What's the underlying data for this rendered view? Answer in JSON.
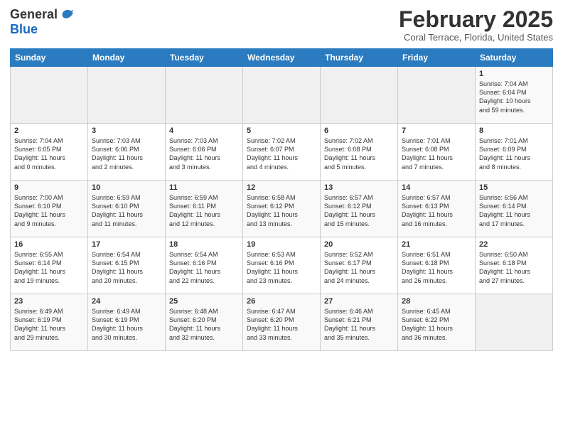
{
  "logo": {
    "general": "General",
    "blue": "Blue"
  },
  "header": {
    "month": "February 2025",
    "location": "Coral Terrace, Florida, United States"
  },
  "days_of_week": [
    "Sunday",
    "Monday",
    "Tuesday",
    "Wednesday",
    "Thursday",
    "Friday",
    "Saturday"
  ],
  "weeks": [
    [
      {
        "day": "",
        "info": "",
        "empty": true
      },
      {
        "day": "",
        "info": "",
        "empty": true
      },
      {
        "day": "",
        "info": "",
        "empty": true
      },
      {
        "day": "",
        "info": "",
        "empty": true
      },
      {
        "day": "",
        "info": "",
        "empty": true
      },
      {
        "day": "",
        "info": "",
        "empty": true
      },
      {
        "day": "1",
        "info": "Sunrise: 7:04 AM\nSunset: 6:04 PM\nDaylight: 10 hours\nand 59 minutes."
      }
    ],
    [
      {
        "day": "2",
        "info": "Sunrise: 7:04 AM\nSunset: 6:05 PM\nDaylight: 11 hours\nand 0 minutes."
      },
      {
        "day": "3",
        "info": "Sunrise: 7:03 AM\nSunset: 6:06 PM\nDaylight: 11 hours\nand 2 minutes."
      },
      {
        "day": "4",
        "info": "Sunrise: 7:03 AM\nSunset: 6:06 PM\nDaylight: 11 hours\nand 3 minutes."
      },
      {
        "day": "5",
        "info": "Sunrise: 7:02 AM\nSunset: 6:07 PM\nDaylight: 11 hours\nand 4 minutes."
      },
      {
        "day": "6",
        "info": "Sunrise: 7:02 AM\nSunset: 6:08 PM\nDaylight: 11 hours\nand 5 minutes."
      },
      {
        "day": "7",
        "info": "Sunrise: 7:01 AM\nSunset: 6:08 PM\nDaylight: 11 hours\nand 7 minutes."
      },
      {
        "day": "8",
        "info": "Sunrise: 7:01 AM\nSunset: 6:09 PM\nDaylight: 11 hours\nand 8 minutes."
      }
    ],
    [
      {
        "day": "9",
        "info": "Sunrise: 7:00 AM\nSunset: 6:10 PM\nDaylight: 11 hours\nand 9 minutes."
      },
      {
        "day": "10",
        "info": "Sunrise: 6:59 AM\nSunset: 6:10 PM\nDaylight: 11 hours\nand 11 minutes."
      },
      {
        "day": "11",
        "info": "Sunrise: 6:59 AM\nSunset: 6:11 PM\nDaylight: 11 hours\nand 12 minutes."
      },
      {
        "day": "12",
        "info": "Sunrise: 6:58 AM\nSunset: 6:12 PM\nDaylight: 11 hours\nand 13 minutes."
      },
      {
        "day": "13",
        "info": "Sunrise: 6:57 AM\nSunset: 6:12 PM\nDaylight: 11 hours\nand 15 minutes."
      },
      {
        "day": "14",
        "info": "Sunrise: 6:57 AM\nSunset: 6:13 PM\nDaylight: 11 hours\nand 16 minutes."
      },
      {
        "day": "15",
        "info": "Sunrise: 6:56 AM\nSunset: 6:14 PM\nDaylight: 11 hours\nand 17 minutes."
      }
    ],
    [
      {
        "day": "16",
        "info": "Sunrise: 6:55 AM\nSunset: 6:14 PM\nDaylight: 11 hours\nand 19 minutes."
      },
      {
        "day": "17",
        "info": "Sunrise: 6:54 AM\nSunset: 6:15 PM\nDaylight: 11 hours\nand 20 minutes."
      },
      {
        "day": "18",
        "info": "Sunrise: 6:54 AM\nSunset: 6:16 PM\nDaylight: 11 hours\nand 22 minutes."
      },
      {
        "day": "19",
        "info": "Sunrise: 6:53 AM\nSunset: 6:16 PM\nDaylight: 11 hours\nand 23 minutes."
      },
      {
        "day": "20",
        "info": "Sunrise: 6:52 AM\nSunset: 6:17 PM\nDaylight: 11 hours\nand 24 minutes."
      },
      {
        "day": "21",
        "info": "Sunrise: 6:51 AM\nSunset: 6:18 PM\nDaylight: 11 hours\nand 26 minutes."
      },
      {
        "day": "22",
        "info": "Sunrise: 6:50 AM\nSunset: 6:18 PM\nDaylight: 11 hours\nand 27 minutes."
      }
    ],
    [
      {
        "day": "23",
        "info": "Sunrise: 6:49 AM\nSunset: 6:19 PM\nDaylight: 11 hours\nand 29 minutes."
      },
      {
        "day": "24",
        "info": "Sunrise: 6:49 AM\nSunset: 6:19 PM\nDaylight: 11 hours\nand 30 minutes."
      },
      {
        "day": "25",
        "info": "Sunrise: 6:48 AM\nSunset: 6:20 PM\nDaylight: 11 hours\nand 32 minutes."
      },
      {
        "day": "26",
        "info": "Sunrise: 6:47 AM\nSunset: 6:20 PM\nDaylight: 11 hours\nand 33 minutes."
      },
      {
        "day": "27",
        "info": "Sunrise: 6:46 AM\nSunset: 6:21 PM\nDaylight: 11 hours\nand 35 minutes."
      },
      {
        "day": "28",
        "info": "Sunrise: 6:45 AM\nSunset: 6:22 PM\nDaylight: 11 hours\nand 36 minutes."
      },
      {
        "day": "",
        "info": "",
        "empty": true
      }
    ]
  ]
}
